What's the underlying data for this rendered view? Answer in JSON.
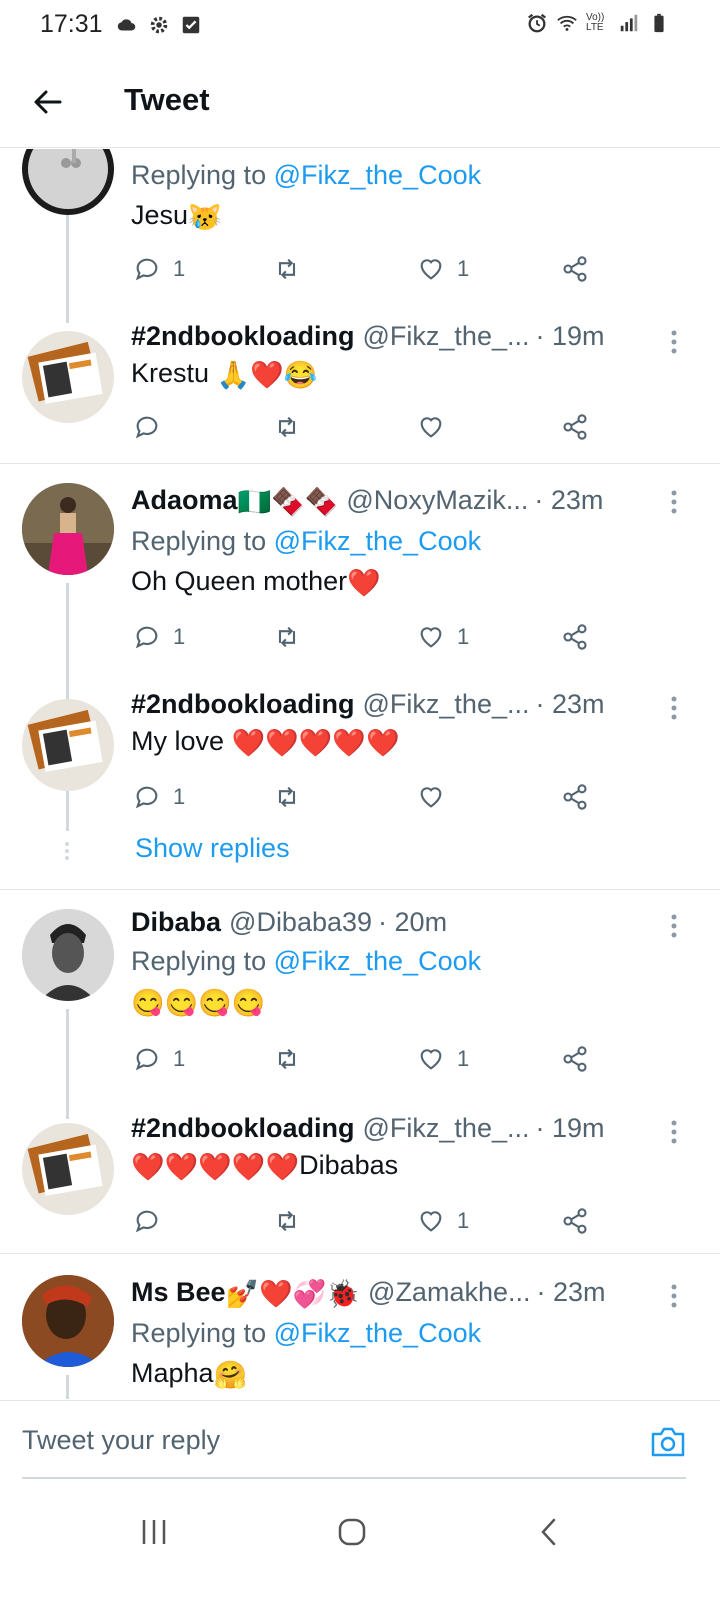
{
  "status_bar": {
    "time": "17:31",
    "lte_label": "Vo)) LTE"
  },
  "header": {
    "title": "Tweet"
  },
  "tweets": [
    {
      "name": "",
      "handle": "",
      "time": "",
      "replying_prefix": "Replying to",
      "replying_handle": "@Fikz_the_Cook",
      "text": "Jesu",
      "emoji": "😿",
      "reply_count": "1",
      "like_count": "1"
    },
    {
      "name": "#2ndbookloading",
      "handle": "@Fikz_the_...",
      "time": "· 19m",
      "text": "Krestu ",
      "emoji": "🙏❤️😂",
      "reply_count": "",
      "like_count": ""
    },
    {
      "name": "Adaoma",
      "name_emoji": "🇳🇬🍫🍫",
      "handle": "@NoxyMazik...",
      "time": "· 23m",
      "replying_prefix": "Replying to",
      "replying_handle": "@Fikz_the_Cook",
      "text": "Oh Queen mother",
      "emoji": "❤️",
      "reply_count": "1",
      "like_count": "1"
    },
    {
      "name": "#2ndbookloading",
      "handle": "@Fikz_the_...",
      "time": "· 23m",
      "text": "My love ",
      "emoji": "❤️❤️❤️❤️❤️",
      "reply_count": "1",
      "like_count": ""
    },
    {
      "name": "Dibaba",
      "handle": "@Dibaba39",
      "time": "· 20m",
      "replying_prefix": "Replying to",
      "replying_handle": "@Fikz_the_Cook",
      "text": "",
      "emoji": "😋😋😋😋",
      "reply_count": "1",
      "like_count": "1"
    },
    {
      "name": "#2ndbookloading",
      "handle": "@Fikz_the_...",
      "time": "· 19m",
      "text": "Dibabas",
      "emoji": "❤️❤️❤️❤️❤️",
      "reply_count": "",
      "like_count": "1"
    },
    {
      "name": "Ms Bee",
      "name_emoji": "💅❤️💞🐞",
      "handle": "@Zamakhe...",
      "time": "· 23m",
      "replying_prefix": "Replying to",
      "replying_handle": "@Fikz_the_Cook",
      "text": "Mapha",
      "emoji": "🤗"
    }
  ],
  "show_replies": "Show replies",
  "reply_bar": {
    "placeholder": "Tweet your reply"
  },
  "colors": {
    "link": "#1d9bf0",
    "muted": "#536471",
    "heart": "#e0245e"
  },
  "icons": [
    "back-arrow-icon",
    "reply-icon",
    "retweet-icon",
    "like-icon",
    "share-icon",
    "more-vertical-icon",
    "camera-icon"
  ]
}
